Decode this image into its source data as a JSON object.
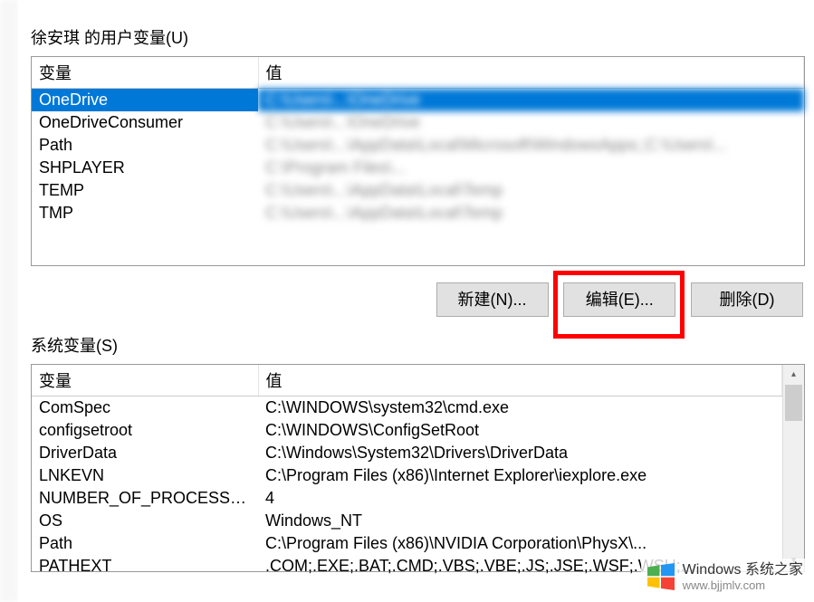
{
  "userSection": {
    "label": "徐安琪 的用户变量(U)",
    "columns": {
      "var": "变量",
      "val": "值"
    },
    "rows": [
      {
        "var": "OneDrive",
        "val": "C:\\Users\\...\\OneDrive",
        "selected": true,
        "blurValue": true
      },
      {
        "var": "OneDriveConsumer",
        "val": "C:\\Users\\...\\OneDrive",
        "blurValue": true
      },
      {
        "var": "Path",
        "val": "C:\\Users\\...\\AppData\\Local\\Microsoft\\WindowsApps;;C:\\Users\\...",
        "blurValue": true
      },
      {
        "var": "SHPLAYER",
        "val": "C:\\Program Files\\...",
        "blurValue": true
      },
      {
        "var": "TEMP",
        "val": "C:\\Users\\...\\AppData\\Local\\Temp",
        "blurValue": true
      },
      {
        "var": "TMP",
        "val": "C:\\Users\\...\\AppData\\Local\\Temp",
        "blurValue": true
      }
    ]
  },
  "buttons": {
    "new": "新建(N)...",
    "edit": "编辑(E)...",
    "delete": "删除(D)"
  },
  "sysSection": {
    "label": "系统变量(S)",
    "columns": {
      "var": "变量",
      "val": "值"
    },
    "rows": [
      {
        "var": "ComSpec",
        "val": "C:\\WINDOWS\\system32\\cmd.exe"
      },
      {
        "var": "configsetroot",
        "val": "C:\\WINDOWS\\ConfigSetRoot"
      },
      {
        "var": "DriverData",
        "val": "C:\\Windows\\System32\\Drivers\\DriverData"
      },
      {
        "var": "LNKEVN",
        "val": "C:\\Program Files (x86)\\Internet Explorer\\iexplore.exe"
      },
      {
        "var": "NUMBER_OF_PROCESSORS",
        "val": "4"
      },
      {
        "var": "OS",
        "val": "Windows_NT"
      },
      {
        "var": "Path",
        "val": "C:\\Program Files (x86)\\NVIDIA Corporation\\PhysX\\..."
      },
      {
        "var": "PATHEXT",
        "val": ".COM;.EXE;.BAT;.CMD;.VBS;.VBE;.JS;.JSE;.WSF;.WSH;..."
      }
    ]
  },
  "watermark": {
    "brand": "Windows 系统之家",
    "url": "www.bjjmlv.com"
  },
  "colors": {
    "selection": "#0078d7",
    "highlight": "#ff0000"
  }
}
